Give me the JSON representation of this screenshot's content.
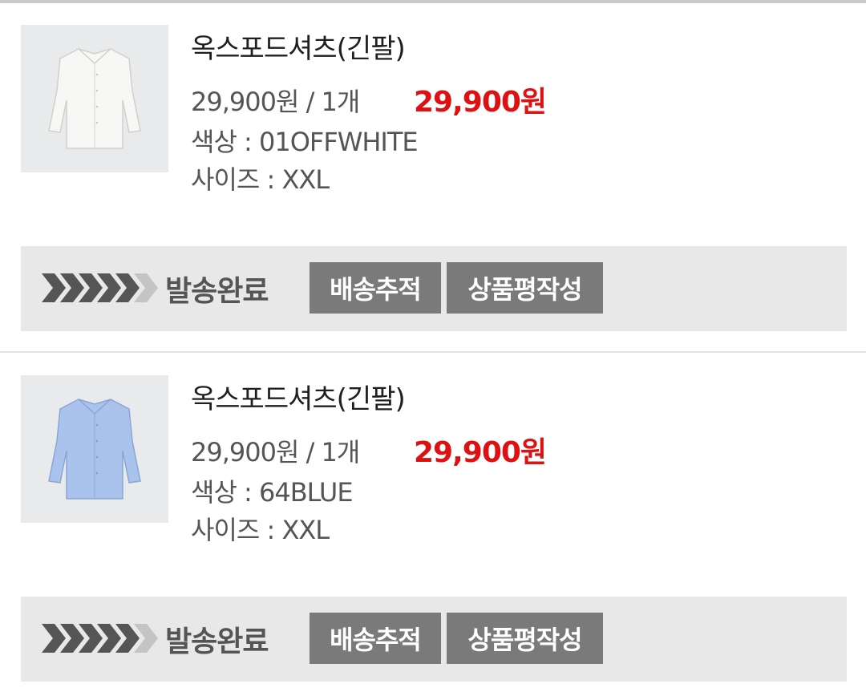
{
  "orders": [
    {
      "product_name": "옥스포드셔츠(긴팔)",
      "unit_price": "29,900원 / 1개",
      "total_price": "29,900원",
      "color_option": "색상 : 01OFFWHITE",
      "size_option": "사이즈 : XXL",
      "thumbnail_color": "#f7f7f5",
      "status": "발송완료",
      "track_button": "배송추적",
      "review_button": "상품평작성"
    },
    {
      "product_name": "옥스포드셔츠(긴팔)",
      "unit_price": "29,900원 / 1개",
      "total_price": "29,900원",
      "color_option": "색상 : 64BLUE",
      "size_option": "사이즈 : XXL",
      "thumbnail_color": "#a9c3ec",
      "status": "발송완료",
      "track_button": "배송추적",
      "review_button": "상품평작성"
    }
  ],
  "colors": {
    "price_red": "#dd1111",
    "button_gray": "#7a7a7a",
    "status_bar_bg": "#e8e8e8",
    "thumbnail_bg": "#e9eaec"
  }
}
